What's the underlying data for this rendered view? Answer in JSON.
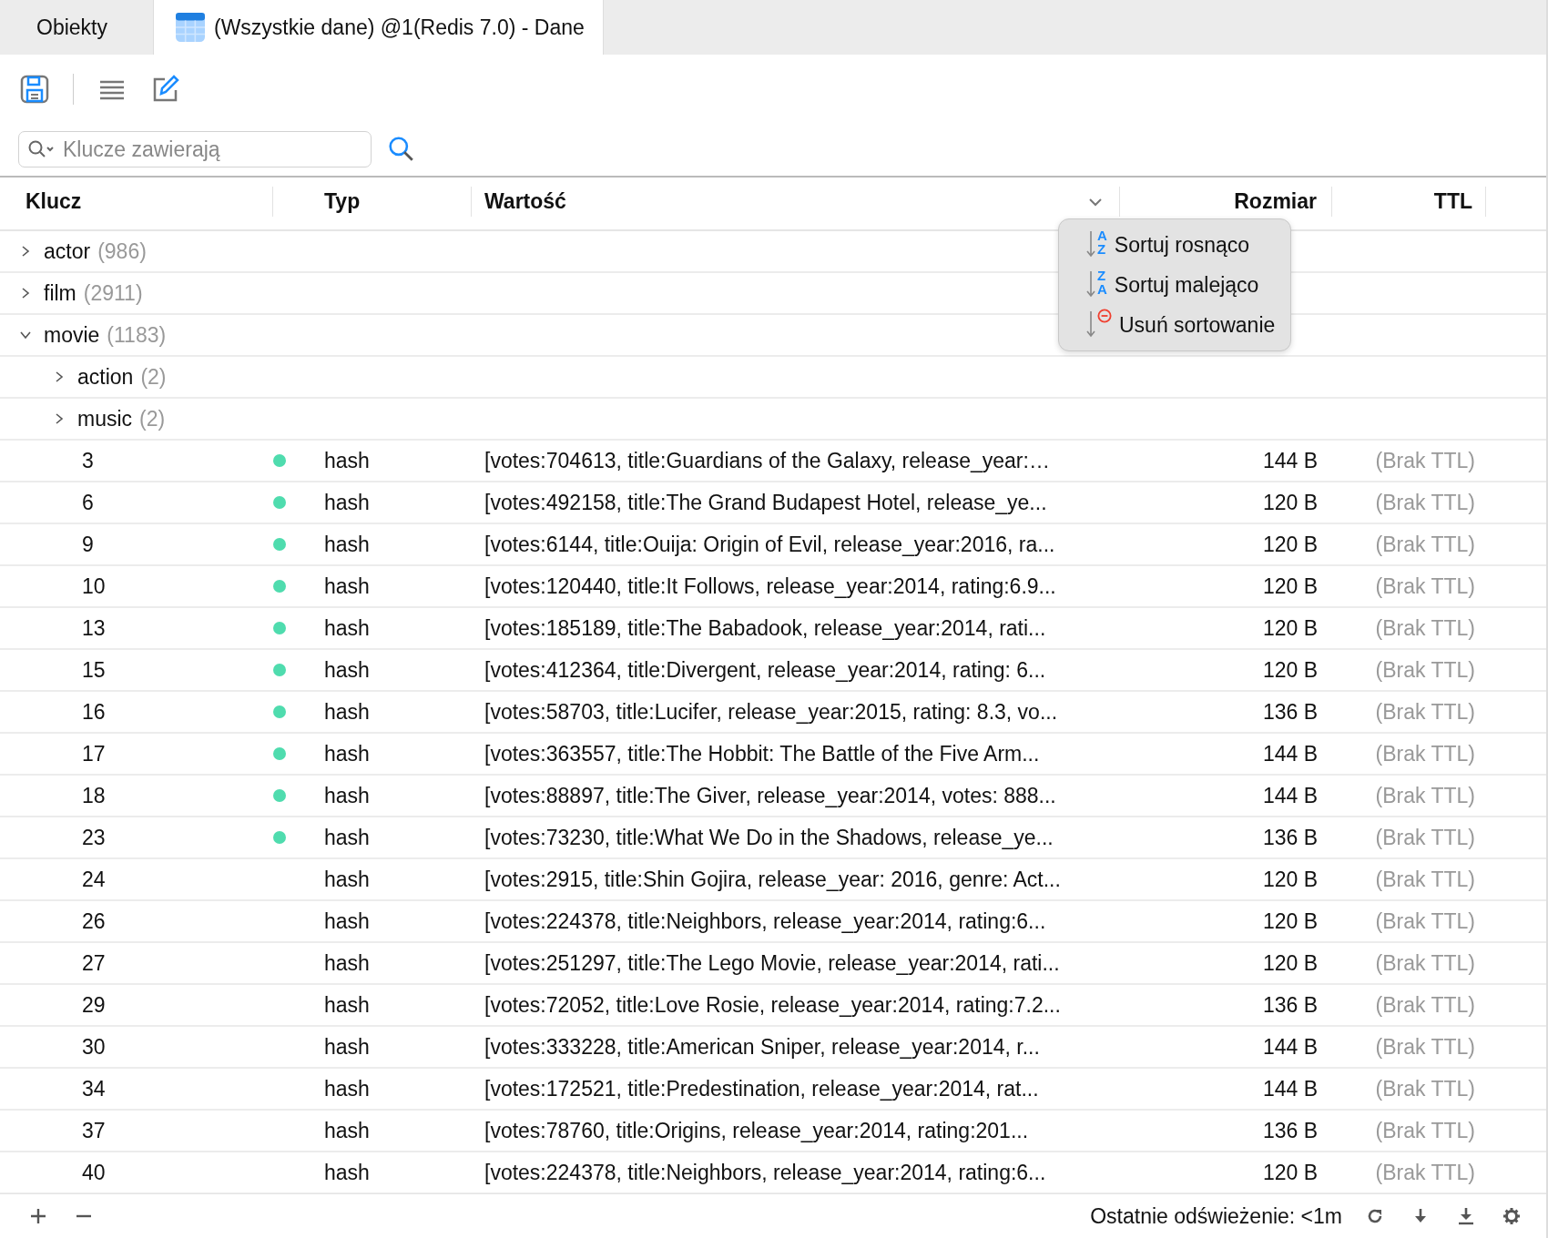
{
  "tabs": [
    {
      "label": "Obiekty",
      "selected": false,
      "kind": "plain"
    },
    {
      "label": "(Wszystkie dane) @1(Redis 7.0) - Dane",
      "selected": true,
      "kind": "table"
    }
  ],
  "search": {
    "placeholder": "Klucze zawierają"
  },
  "table": {
    "columns": [
      "Klucz",
      "Typ",
      "Wartość",
      "Rozmiar",
      "TTL"
    ],
    "tree": [
      {
        "kind": "folder",
        "name": "actor",
        "count": "(986)",
        "expanded": false
      },
      {
        "kind": "folder",
        "name": "film",
        "count": "(2911)",
        "expanded": false
      },
      {
        "kind": "folder",
        "name": "movie",
        "count": "(1183)",
        "expanded": true,
        "children": [
          {
            "kind": "folder",
            "name": "action",
            "count": "(2)",
            "expanded": false
          },
          {
            "kind": "folder",
            "name": "music",
            "count": "(2)",
            "expanded": false
          },
          {
            "kind": "key",
            "name": "3",
            "marked": true,
            "type": "hash",
            "value": "[votes:704613, title:Guardians of the Galaxy, release_year:…",
            "size": "144 B",
            "ttl": "(Brak TTL)"
          },
          {
            "kind": "key",
            "name": "6",
            "marked": true,
            "type": "hash",
            "value": "[votes:492158, title:The Grand Budapest Hotel, release_ye...",
            "size": "120 B",
            "ttl": "(Brak TTL)"
          },
          {
            "kind": "key",
            "name": "9",
            "marked": true,
            "type": "hash",
            "value": "[votes:6144, title:Ouija: Origin of Evil, release_year:2016, ra...",
            "size": "120 B",
            "ttl": "(Brak TTL)"
          },
          {
            "kind": "key",
            "name": "10",
            "marked": true,
            "type": "hash",
            "value": "[votes:120440, title:It Follows, release_year:2014, rating:6.9...",
            "size": "120 B",
            "ttl": "(Brak TTL)"
          },
          {
            "kind": "key",
            "name": "13",
            "marked": true,
            "type": "hash",
            "value": "[votes:185189, title:The Babadook, release_year:2014, rati...",
            "size": "120 B",
            "ttl": "(Brak TTL)"
          },
          {
            "kind": "key",
            "name": "15",
            "marked": true,
            "type": "hash",
            "value": "[votes:412364, title:Divergent, release_year:2014, rating: 6...",
            "size": "120 B",
            "ttl": "(Brak TTL)"
          },
          {
            "kind": "key",
            "name": "16",
            "marked": true,
            "type": "hash",
            "value": "[votes:58703, title:Lucifer, release_year:2015, rating: 8.3, vo...",
            "size": "136 B",
            "ttl": "(Brak TTL)"
          },
          {
            "kind": "key",
            "name": "17",
            "marked": true,
            "type": "hash",
            "value": "[votes:363557, title:The Hobbit: The Battle of the Five Arm...",
            "size": "144 B",
            "ttl": "(Brak TTL)"
          },
          {
            "kind": "key",
            "name": "18",
            "marked": true,
            "type": "hash",
            "value": "[votes:88897, title:The Giver, release_year:2014, votes: 888...",
            "size": "144 B",
            "ttl": "(Brak TTL)"
          },
          {
            "kind": "key",
            "name": "23",
            "marked": true,
            "type": "hash",
            "value": "[votes:73230, title:What We Do in the Shadows, release_ye...",
            "size": "136 B",
            "ttl": "(Brak TTL)"
          },
          {
            "kind": "key",
            "name": "24",
            "marked": false,
            "type": "hash",
            "value": "[votes:2915, title:Shin Gojira, release_year: 2016, genre: Act...",
            "size": "120 B",
            "ttl": "(Brak TTL)"
          },
          {
            "kind": "key",
            "name": "26",
            "marked": false,
            "type": "hash",
            "value": "[votes:224378, title:Neighbors, release_year:2014, rating:6...",
            "size": "120 B",
            "ttl": "(Brak TTL)"
          },
          {
            "kind": "key",
            "name": "27",
            "marked": false,
            "type": "hash",
            "value": "[votes:251297, title:The Lego Movie, release_year:2014, rati...",
            "size": "120 B",
            "ttl": "(Brak TTL)"
          },
          {
            "kind": "key",
            "name": "29",
            "marked": false,
            "type": "hash",
            "value": "[votes:72052, title:Love Rosie, release_year:2014, rating:7.2...",
            "size": "136 B",
            "ttl": "(Brak TTL)"
          },
          {
            "kind": "key",
            "name": "30",
            "marked": false,
            "type": "hash",
            "value": "[votes:333228, title:American Sniper, release_year:2014, r...",
            "size": "144 B",
            "ttl": "(Brak TTL)"
          },
          {
            "kind": "key",
            "name": "34",
            "marked": false,
            "type": "hash",
            "value": "[votes:172521, title:Predestination, release_year:2014, rat...",
            "size": "144 B",
            "ttl": "(Brak TTL)"
          },
          {
            "kind": "key",
            "name": "37",
            "marked": false,
            "type": "hash",
            "value": "[votes:78760, title:Origins, release_year:2014, rating:201...",
            "size": "136 B",
            "ttl": "(Brak TTL)"
          },
          {
            "kind": "key",
            "name": "40",
            "marked": false,
            "type": "hash",
            "value": "[votes:224378, title:Neighbors, release_year:2014, rating:6...",
            "size": "120 B",
            "ttl": "(Brak TTL)"
          }
        ]
      }
    ]
  },
  "sort_menu": [
    {
      "kind": "asc",
      "icon_letters": [
        "A",
        "Z"
      ],
      "label": "Sortuj rosnąco"
    },
    {
      "kind": "desc",
      "icon_letters": [
        "Z",
        "A"
      ],
      "label": "Sortuj malejąco"
    },
    {
      "kind": "clear",
      "label": "Usuń sortowanie"
    }
  ],
  "status_bar": {
    "refresh": "Ostatnie odświeżenie: <1m"
  }
}
